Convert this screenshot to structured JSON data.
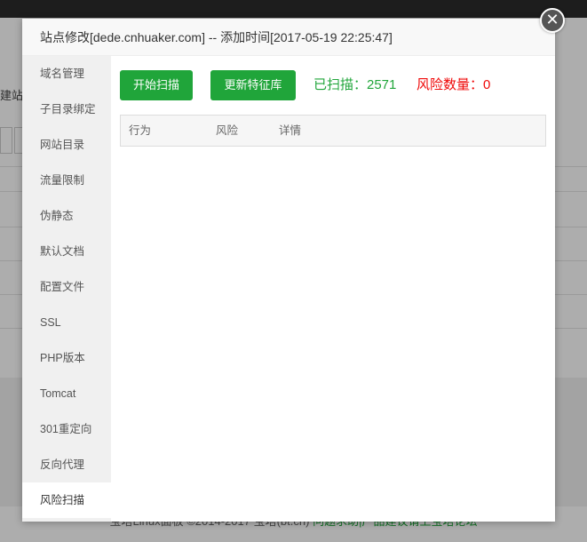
{
  "background": {
    "side_fragment": "建站",
    "footer_text": "宝塔Linux面板 ©2014-2017 宝塔(bt.cn)",
    "footer_link": "问题求助|产品建议请上宝塔论坛"
  },
  "modal": {
    "title": "站点修改[dede.cnhuaker.com] -- 添加时间[2017-05-19 22:25:47]",
    "close_symbol": "✕"
  },
  "sidebar": {
    "items": [
      {
        "label": "域名管理"
      },
      {
        "label": "子目录绑定"
      },
      {
        "label": "网站目录"
      },
      {
        "label": "流量限制"
      },
      {
        "label": "伪静态"
      },
      {
        "label": "默认文档"
      },
      {
        "label": "配置文件"
      },
      {
        "label": "SSL"
      },
      {
        "label": "PHP版本"
      },
      {
        "label": "Tomcat"
      },
      {
        "label": "301重定向"
      },
      {
        "label": "反向代理"
      },
      {
        "label": "风险扫描"
      }
    ],
    "active_index": 12
  },
  "toolbar": {
    "scan_label": "开始扫描",
    "update_label": "更新特征库",
    "scanned_text": "已扫描：2571",
    "risk_text": "风险数量：0"
  },
  "table": {
    "columns": [
      "行为",
      "风险",
      "详情"
    ],
    "rows": []
  },
  "colors": {
    "accent": "#20a53a",
    "danger": "#ef0808",
    "sidebar_bg": "#f0f0f0"
  }
}
